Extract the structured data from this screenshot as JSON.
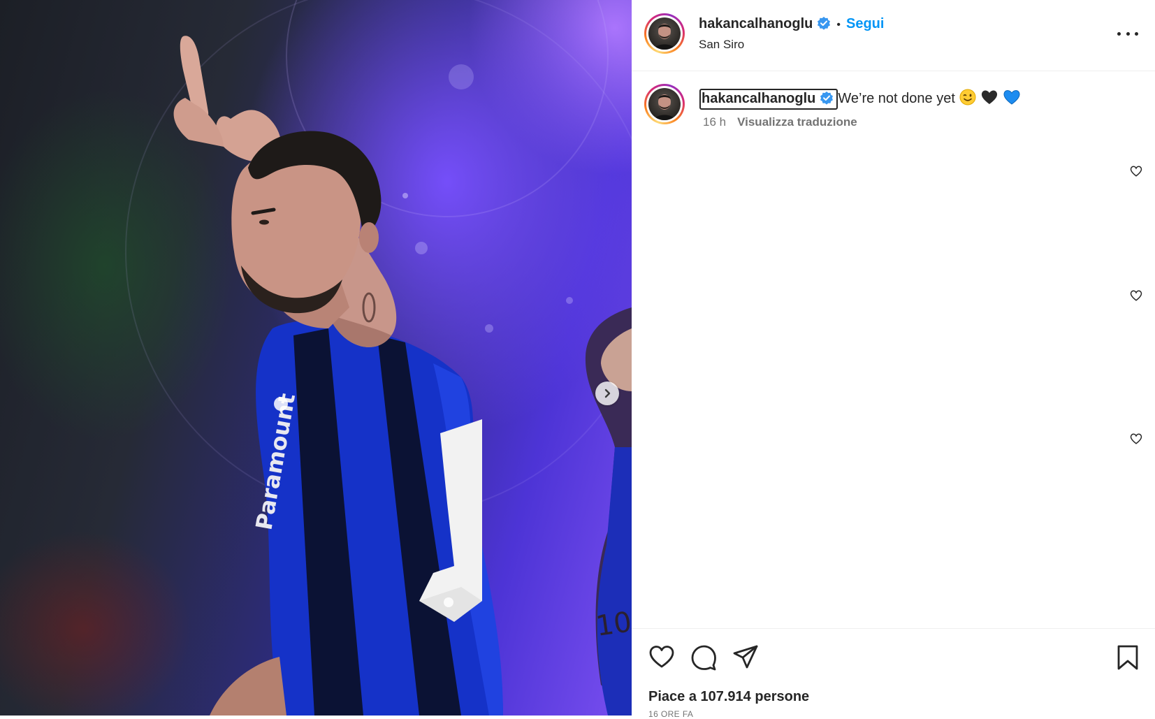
{
  "post": {
    "username": "hakancalhanoglu",
    "follow_label": "Segui",
    "separator": "•",
    "location": "San Siro",
    "more_options_icon": "more-horizontal-icon"
  },
  "caption": {
    "username": "hakancalhanoglu",
    "text": "We’re not done yet",
    "emojis": [
      "winking-face",
      "black-heart",
      "blue-heart"
    ],
    "time": "16 h",
    "translate_label": "Visualizza traduzione"
  },
  "actions": {
    "like_icon": "heart-icon",
    "comment_icon": "comment-icon",
    "share_icon": "send-icon",
    "save_icon": "bookmark-icon"
  },
  "likes_text": "Piace a 107.914 persone",
  "time_ago": "16 ORE FA",
  "colors": {
    "accent": "#0095f6",
    "verified": "#3897f0",
    "jersey_blue": "#1a3fd4",
    "background_purple": "#5a3be0"
  }
}
